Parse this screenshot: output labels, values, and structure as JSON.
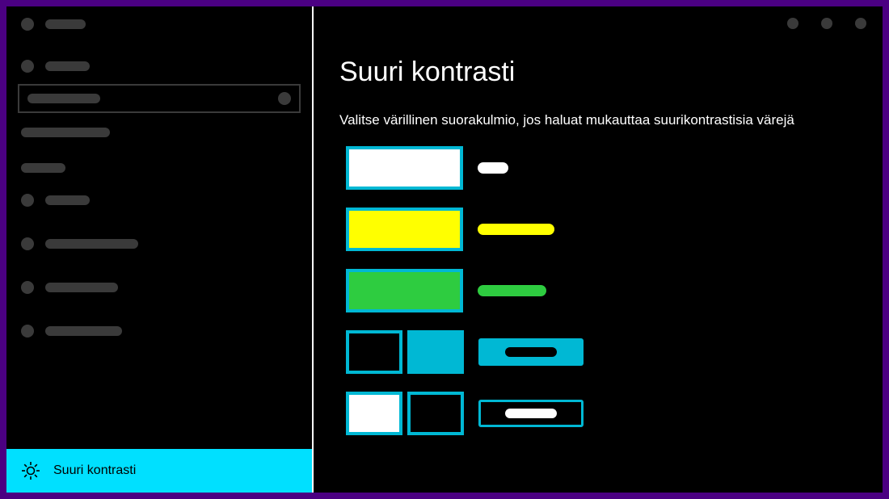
{
  "page": {
    "title": "Suuri kontrasti",
    "subtitle": "Valitse värillinen suorakulmio, jos haluat mukauttaa suurikontrastisia värejä"
  },
  "sidebar": {
    "active_label": "Suuri kontrasti"
  },
  "colors": {
    "accent": "#00b8d4",
    "text_color": "#ffffff",
    "hyperlink_color": "#ffff00",
    "disabled_color": "#2ecc40",
    "selected_bg": "#00b8d4",
    "selected_fg": "#000000",
    "button_bg": "#000000",
    "button_fg": "#ffffff"
  }
}
